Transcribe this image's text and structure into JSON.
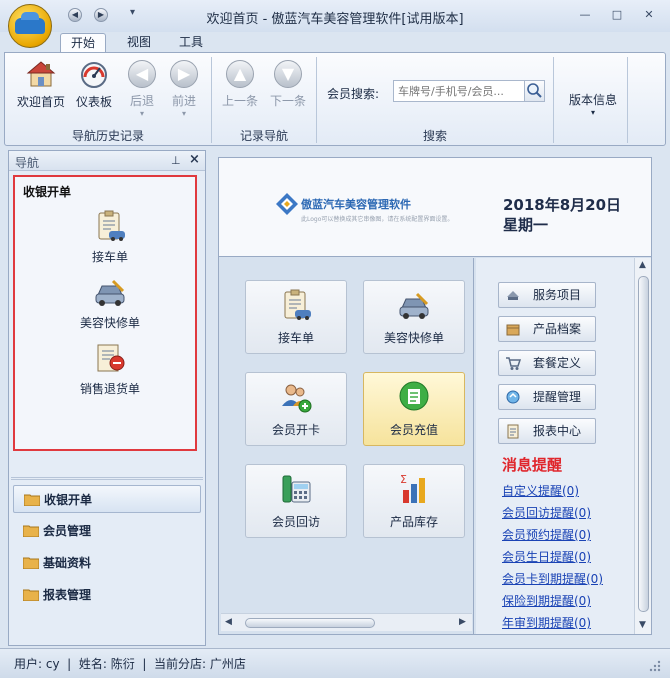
{
  "window": {
    "title": "欢迎首页 - 傲蓝汽车美容管理软件[试用版本]",
    "controls": [
      "—",
      "□",
      "✕"
    ]
  },
  "ribbon": {
    "tabs": [
      {
        "label": "开始",
        "active": true
      },
      {
        "label": "视图",
        "active": false
      },
      {
        "label": "工具",
        "active": false
      }
    ],
    "nav_group": {
      "label": "导航历史记录",
      "buttons": [
        {
          "label": "欢迎首页",
          "icon": "home-icon",
          "enabled": true
        },
        {
          "label": "仪表板",
          "icon": "dashboard-icon",
          "enabled": true
        },
        {
          "label": "后退",
          "icon": "back-arrow-icon",
          "enabled": false
        },
        {
          "label": "前进",
          "icon": "forward-arrow-icon",
          "enabled": false
        }
      ]
    },
    "record_group": {
      "label": "记录导航",
      "buttons": [
        {
          "label": "上一条",
          "icon": "up-arrow-icon",
          "enabled": false
        },
        {
          "label": "下一条",
          "icon": "down-arrow-icon",
          "enabled": false
        }
      ]
    },
    "search_group": {
      "label": "搜索",
      "field_label": "会员搜索:",
      "placeholder": "车牌号/手机号/会员..."
    },
    "version_button": {
      "label": "版本信息"
    }
  },
  "nav_pane": {
    "title": "导航",
    "section_title": "收银开单",
    "items": [
      {
        "label": "接车单",
        "icon": "clipboard-car-icon"
      },
      {
        "label": "美容快修单",
        "icon": "car-repair-icon"
      },
      {
        "label": "销售退货单",
        "icon": "return-order-icon"
      }
    ],
    "categories": [
      {
        "label": "收银开单",
        "active": true
      },
      {
        "label": "会员管理",
        "active": false
      },
      {
        "label": "基础资料",
        "active": false
      },
      {
        "label": "报表管理",
        "active": false
      }
    ]
  },
  "banner": {
    "brand_name": "傲蓝汽车美容管理软件",
    "brand_sub": "此Logo可以替换成其它串像图，请在系统配置界面设置。",
    "date": "2018年8月20日",
    "weekday": "星期一"
  },
  "tiles": [
    {
      "label": "接车单",
      "icon": "clipboard-car-icon",
      "selected": false
    },
    {
      "label": "美容快修单",
      "icon": "car-repair-icon",
      "selected": false
    },
    {
      "label": "会员开卡",
      "icon": "add-member-icon",
      "selected": false
    },
    {
      "label": "会员充值",
      "icon": "recharge-icon",
      "selected": true
    },
    {
      "label": "会员回访",
      "icon": "phone-icon",
      "selected": false
    },
    {
      "label": "产品库存",
      "icon": "bar-chart-icon",
      "selected": false
    }
  ],
  "side_buttons": [
    {
      "label": "服务项目",
      "icon": "service-icon"
    },
    {
      "label": "产品档案",
      "icon": "product-box-icon"
    },
    {
      "label": "套餐定义",
      "icon": "package-cart-icon"
    },
    {
      "label": "提醒管理",
      "icon": "reminder-icon"
    },
    {
      "label": "报表中心",
      "icon": "report-icon"
    }
  ],
  "messages": {
    "title": "消息提醒",
    "links": [
      "自定义提醒(0)",
      "会员回访提醒(0)",
      "会员预约提醒(0)",
      "会员生日提醒(0)",
      "会员卡到期提醒(0)",
      "保险到期提醒(0)",
      "年审到期提醒(0)"
    ]
  },
  "status_bar": {
    "text": "用户: cy  |  姓名: 陈衍  |  当前分店: 广州店"
  }
}
